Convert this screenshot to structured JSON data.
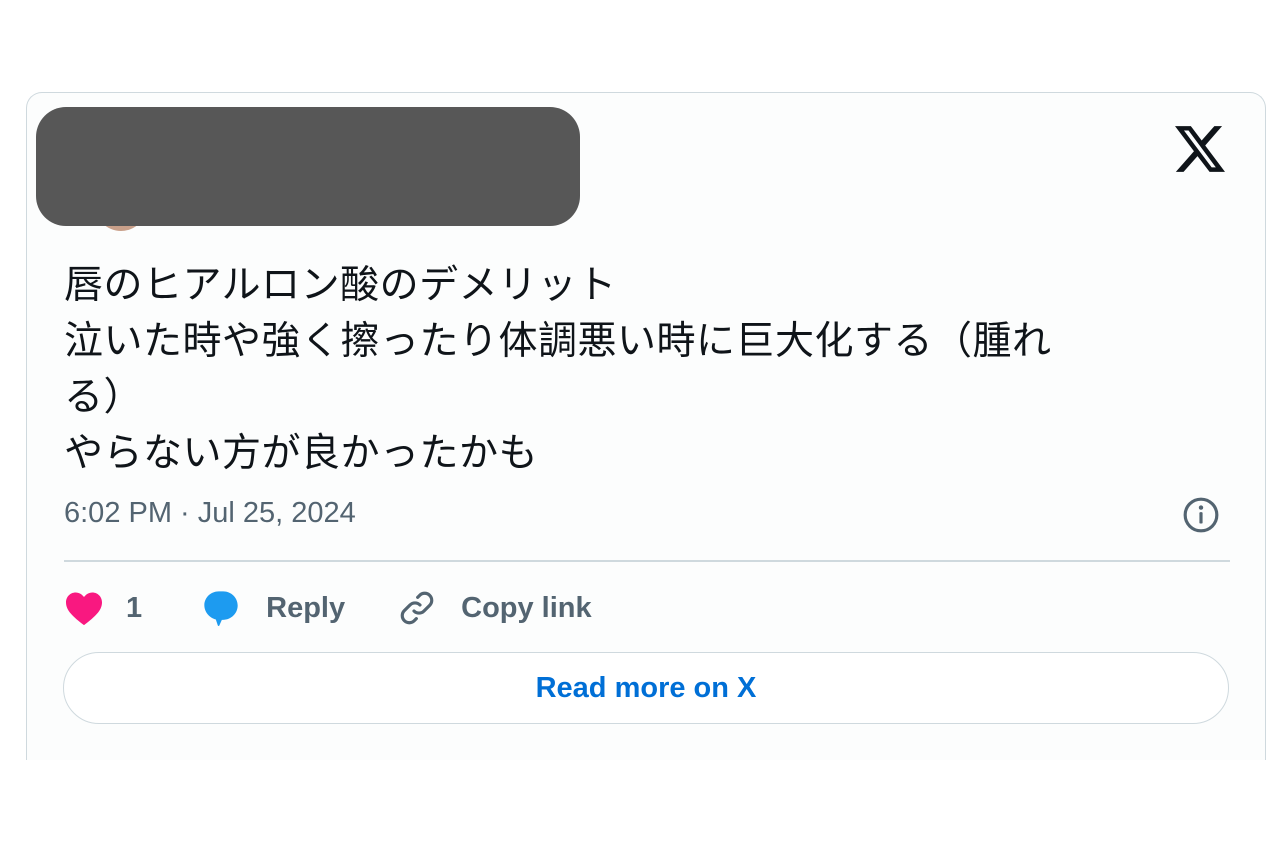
{
  "tweet": {
    "lines": [
      "唇のヒアルロン酸のデメリット",
      "泣いた時や強く擦ったり体調悪い時に巨大化する（腫れ",
      "る）",
      "やらない方が良かったかも"
    ],
    "timestamp": "6:02 PM · Jul 25, 2024"
  },
  "actions": {
    "like_count": "1",
    "reply_label": "Reply",
    "copy_label": "Copy link"
  },
  "read_more_label": "Read more on X",
  "icons": {
    "brand": "x-logo-icon",
    "info": "info-icon",
    "like": "heart-icon",
    "reply": "speech-bubble-icon",
    "copy": "link-icon"
  },
  "colors": {
    "heart": "#f91880",
    "reply_bubble": "#1d9bf0",
    "link_blue": "#006fd6",
    "muted_text": "#536471",
    "body_text": "#0f1419",
    "border": "#cfd9de"
  }
}
